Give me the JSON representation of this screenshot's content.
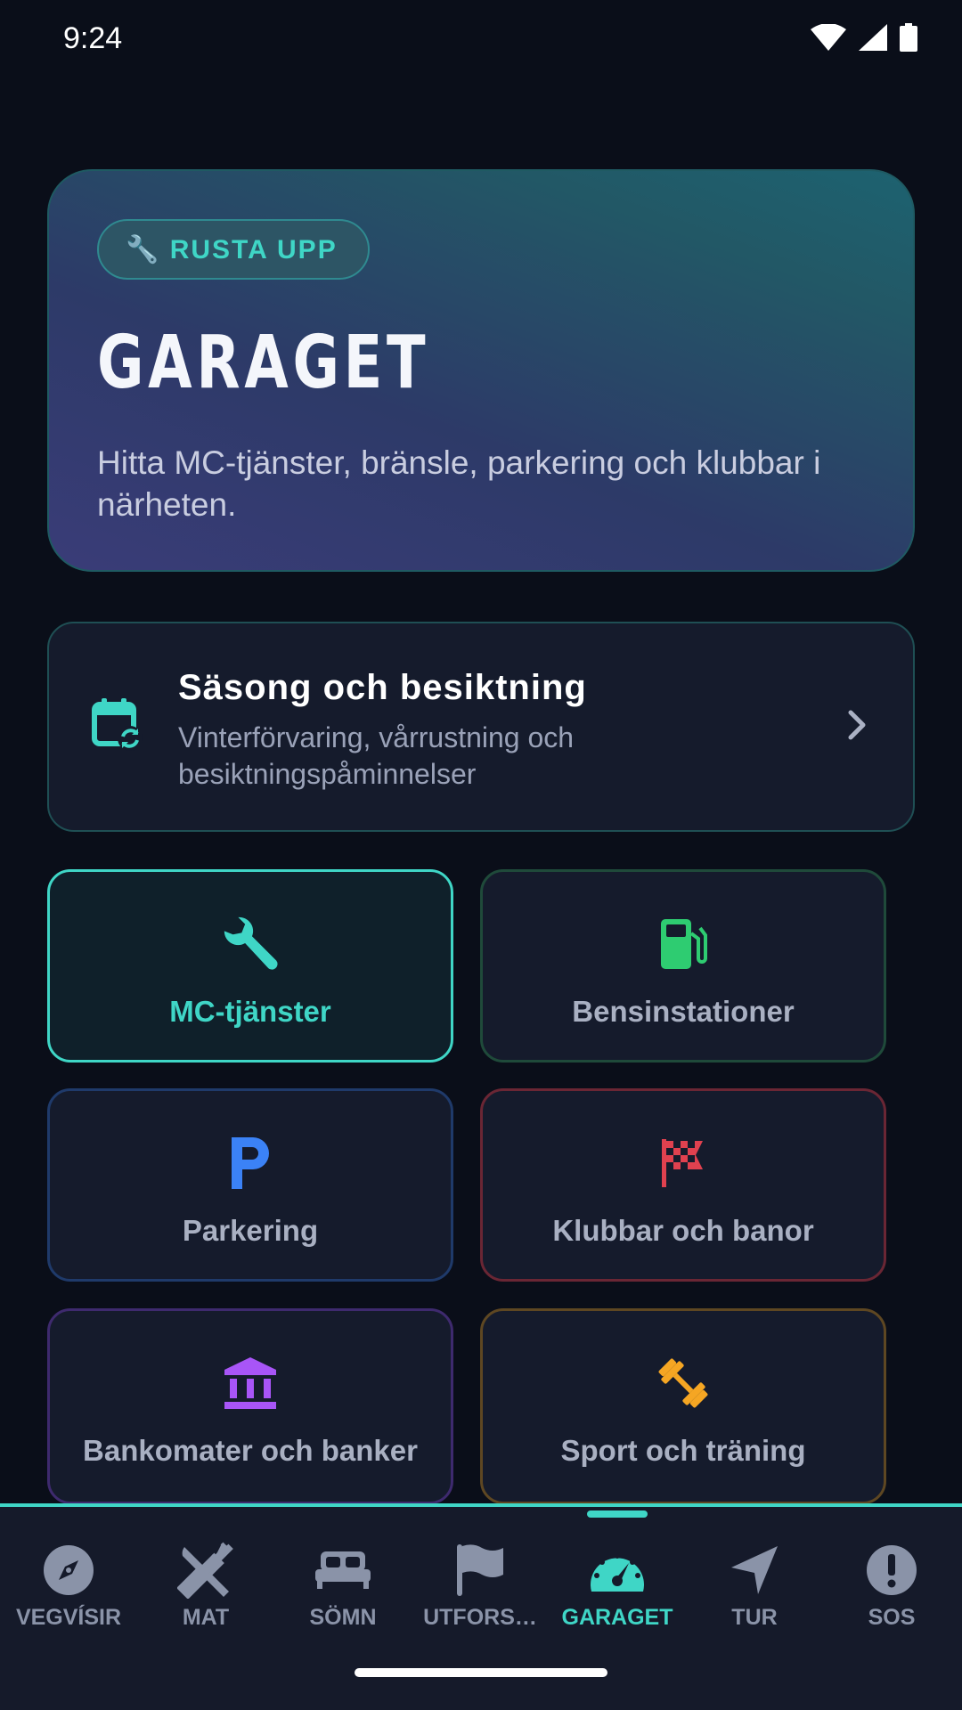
{
  "status": {
    "time": "9:24"
  },
  "hero": {
    "chip_label": "🔧 RUSTA UPP",
    "title": "GARAGET",
    "description": "Hitta MC-tjänster, bränsle, parkering och klubbar i närheten."
  },
  "season": {
    "title": "Säsong och besiktning",
    "subtitle": "Vinterförvaring, vårrustning och besiktningspåminnelser"
  },
  "tiles": [
    {
      "label": "MC-tjänster",
      "icon": "wrench-icon",
      "color": "#3fd6c6"
    },
    {
      "label": "Bensinstationer",
      "icon": "fuel-pump-icon",
      "color": "#2ecc71"
    },
    {
      "label": "Parkering",
      "icon": "parking-icon",
      "color": "#3b82f6"
    },
    {
      "label": "Klubbar och banor",
      "icon": "checkered-flag-icon",
      "color": "#e0414f"
    },
    {
      "label": "Bankomater och banker",
      "icon": "bank-icon",
      "color": "#a855f7"
    },
    {
      "label": "Sport och träning",
      "icon": "dumbbell-icon",
      "color": "#f5a623"
    }
  ],
  "nav": {
    "active": "GARAGET",
    "items": [
      {
        "label": "VEGVÍSIR",
        "icon": "compass-icon"
      },
      {
        "label": "MAT",
        "icon": "utensils-icon"
      },
      {
        "label": "SÖMN",
        "icon": "bed-icon"
      },
      {
        "label": "UTFORS…",
        "icon": "flag-icon"
      },
      {
        "label": "GARAGET",
        "icon": "speedometer-icon"
      },
      {
        "label": "TUR",
        "icon": "navigation-arrow-icon"
      },
      {
        "label": "SOS",
        "icon": "alert-icon"
      }
    ]
  },
  "colors": {
    "accent": "#3fd6c6",
    "background": "#0a0e19",
    "card": "#151b2c"
  }
}
